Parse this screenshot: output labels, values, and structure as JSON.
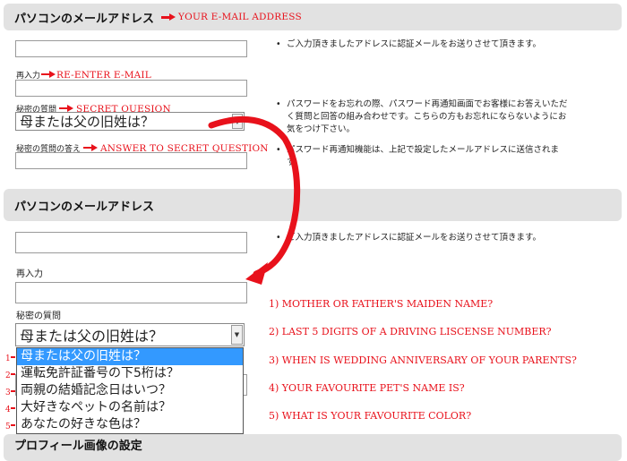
{
  "section1": {
    "header": "パソコンのメールアドレス",
    "header_note": "YOUR E-MAIL ADDRESS",
    "reenter_label": "再入力",
    "reenter_note": "RE-ENTER E-MAIL",
    "secret_label": "秘密の質問",
    "secret_note": "SECRET QUESION",
    "secret_value": "母または父の旧姓は？",
    "answer_label": "秘密の質問の答え",
    "answer_note": "ANSWER TO SECRET QUESTION",
    "note_email": "ご入力頂きましたアドレスに認証メールをお送りさせて頂きます。",
    "note_password_1": "パスワードをお忘れの際、パスワード再通知画面でお客様にお答えいただ",
    "note_password_2": "く質問と回答の組み合わせです。こちらの方もお忘れにならないようにお",
    "note_password_3": "気をつけ下さい。",
    "note_resend_1": "パスワード再通知機能は、上記で設定したメールアドレスに送信されま",
    "note_resend_2": "す。"
  },
  "section2": {
    "header": "パソコンのメールアドレス",
    "note_email": "ご入力頂きましたアドレスに認証メールをお送りさせて頂きます。",
    "reenter_label": "再入力",
    "secret_label": "秘密の質問",
    "secret_value": "母または父の旧姓は？",
    "options": [
      {
        "num": "1",
        "label": "母または父の旧姓は？"
      },
      {
        "num": "2",
        "label": "運転免許証番号の下5桁は？"
      },
      {
        "num": "3",
        "label": "両親の結婚記念日はいつ？"
      },
      {
        "num": "4",
        "label": "大好きなペットの名前は？"
      },
      {
        "num": "5",
        "label": "あなたの好きな色は？"
      }
    ],
    "translations": [
      "1) MOTHER OR FATHER'S MAIDEN NAME?",
      "2) LAST 5 DIGITS OF A DRIVING LISCENSE NUMBER?",
      "3) WHEN IS WEDDING ANNIVERSARY OF YOUR PARENTS?",
      "4) YOUR FAVOURITE PET'S NAME IS?",
      "5) WHAT IS YOUR FAVOURITE COLOR?"
    ]
  },
  "section3": {
    "header": "プロフィール画像の設定"
  },
  "colors": {
    "accent_red": "#e8111b",
    "header_bg": "#e2e2e2",
    "selected_option": "#3399ff"
  },
  "icons": {
    "red_arrow": "right-arrow-icon",
    "select_caret": "chevron-down-icon"
  }
}
